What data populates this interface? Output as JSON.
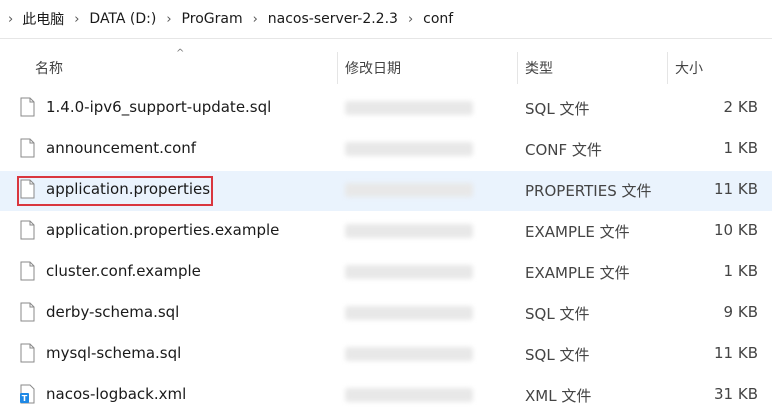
{
  "breadcrumb": {
    "items": [
      "此电脑",
      "DATA (D:)",
      "ProGram",
      "nacos-server-2.2.3",
      "conf"
    ],
    "separator": "›"
  },
  "columns": {
    "name": "名称",
    "modified": "修改日期",
    "type": "类型",
    "size": "大小"
  },
  "files": [
    {
      "name": "1.4.0-ipv6_support-update.sql",
      "type": "SQL 文件",
      "size": "2 KB",
      "icon": "file-icon",
      "selected": false
    },
    {
      "name": "announcement.conf",
      "type": "CONF 文件",
      "size": "1 KB",
      "icon": "file-icon",
      "selected": false
    },
    {
      "name": "application.properties",
      "type": "PROPERTIES 文件",
      "size": "11 KB",
      "icon": "file-icon",
      "selected": true
    },
    {
      "name": "application.properties.example",
      "type": "EXAMPLE 文件",
      "size": "10 KB",
      "icon": "file-icon",
      "selected": false
    },
    {
      "name": "cluster.conf.example",
      "type": "EXAMPLE 文件",
      "size": "1 KB",
      "icon": "file-icon",
      "selected": false
    },
    {
      "name": "derby-schema.sql",
      "type": "SQL 文件",
      "size": "9 KB",
      "icon": "file-icon",
      "selected": false
    },
    {
      "name": "mysql-schema.sql",
      "type": "SQL 文件",
      "size": "11 KB",
      "icon": "file-icon",
      "selected": false
    },
    {
      "name": "nacos-logback.xml",
      "type": "XML 文件",
      "size": "31 KB",
      "icon": "xml-file-icon",
      "selected": false
    }
  ],
  "colors": {
    "selected_row": "#eaf3fd",
    "highlight_border": "#d9363e",
    "xml_icon": "#1e88e5"
  }
}
